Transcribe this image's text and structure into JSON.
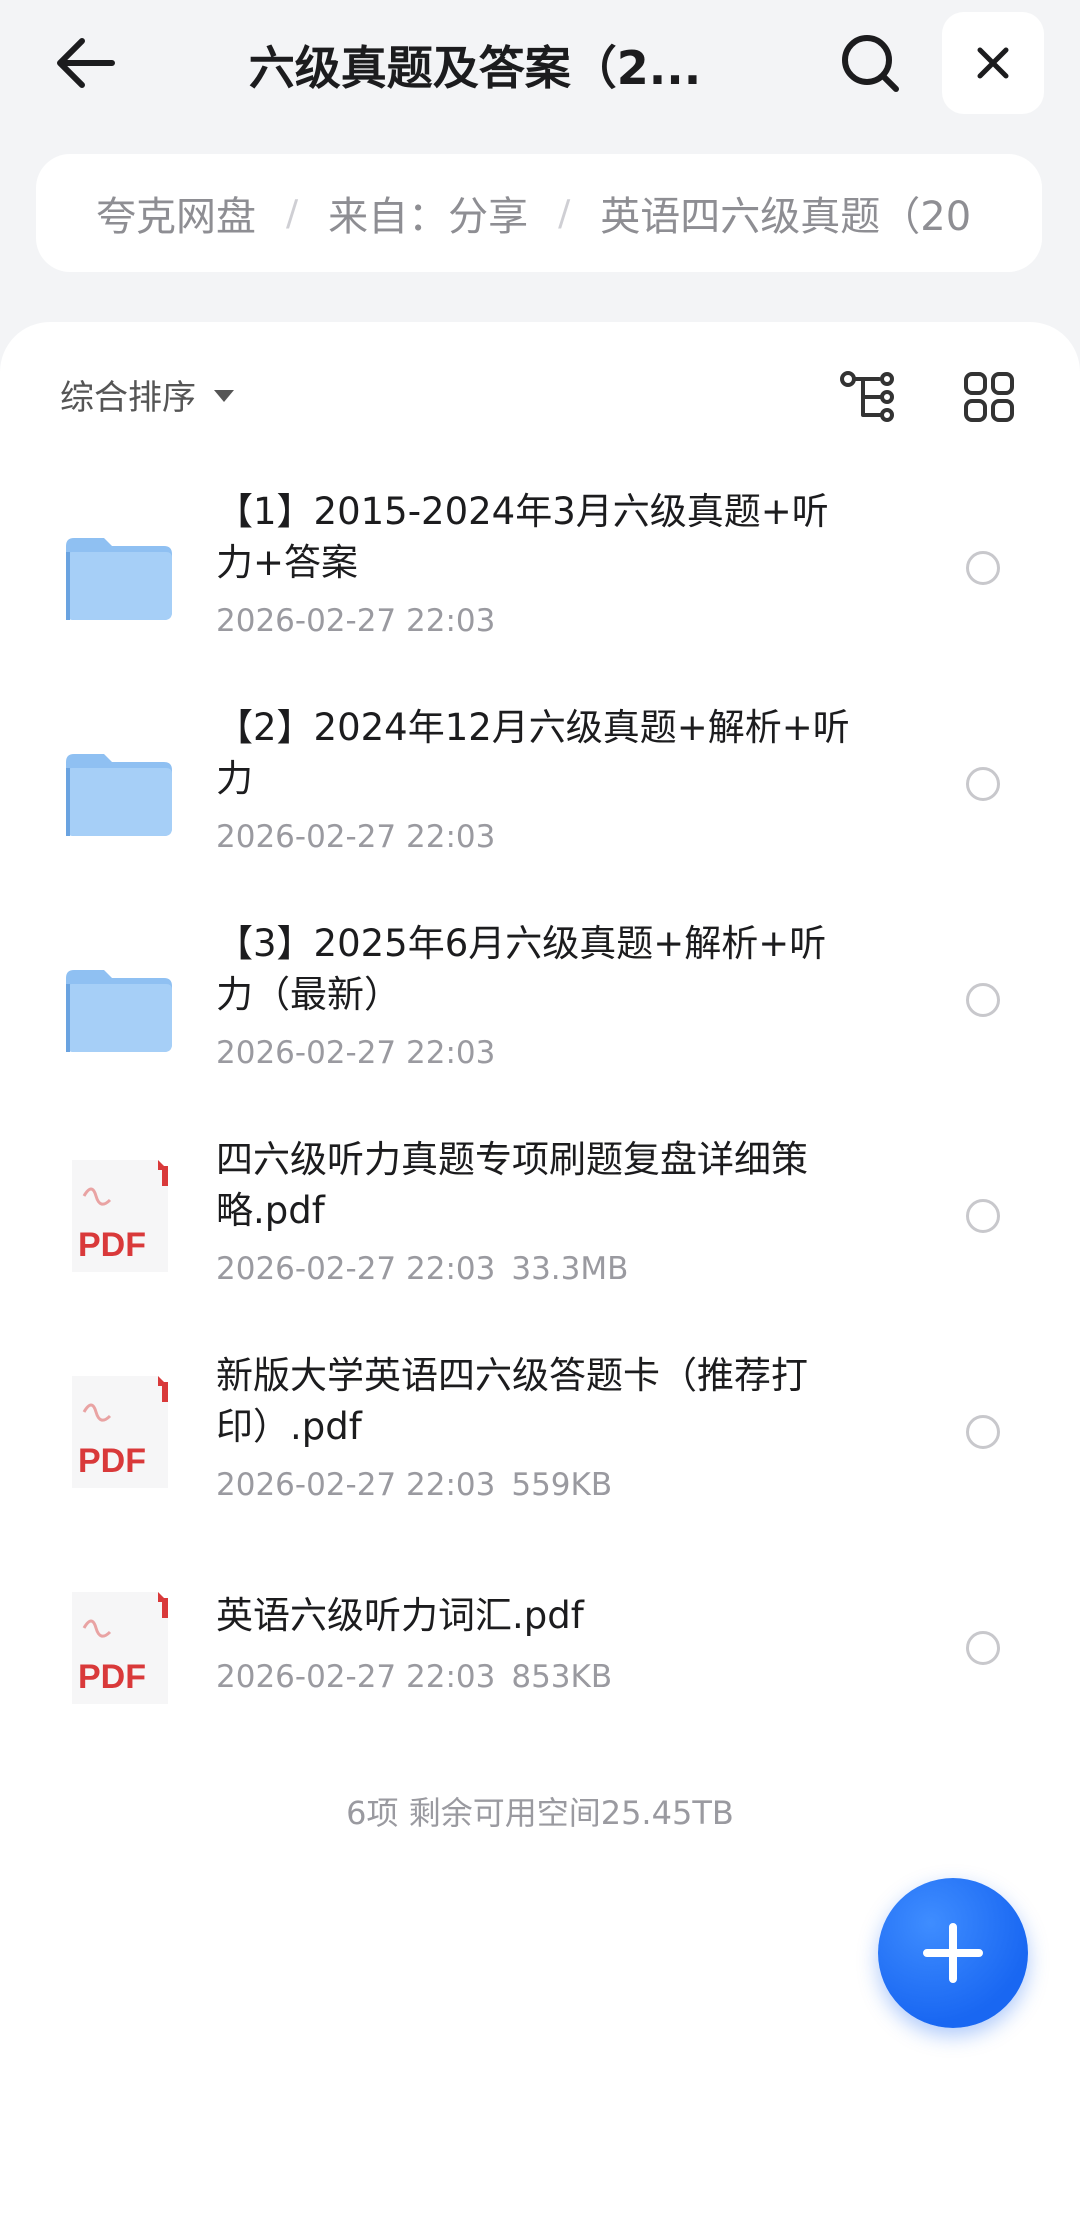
{
  "header": {
    "title": "六级真题及答案（2...",
    "back_icon": "arrow-left-icon",
    "search_icon": "search-icon",
    "close_icon": "close-icon"
  },
  "breadcrumb": {
    "items": [
      "夸克网盘",
      "来自：分享",
      "英语四六级真题（20"
    ],
    "separator": "/"
  },
  "toolbar": {
    "sort_label": "综合排序",
    "tree_icon": "tree-view-icon",
    "grid_icon": "grid-view-icon"
  },
  "files": [
    {
      "type": "folder",
      "name": "【1】2015-2024年3月六级真题+听力+答案",
      "date": "2026-02-27 22:03",
      "size": ""
    },
    {
      "type": "folder",
      "name": "【2】2024年12月六级真题+解析+听力",
      "date": "2026-02-27 22:03",
      "size": ""
    },
    {
      "type": "folder",
      "name": "【3】2025年6月六级真题+解析+听力（最新）",
      "date": "2026-02-27 22:03",
      "size": ""
    },
    {
      "type": "pdf",
      "name": "四六级听力真题专项刷题复盘详细策略.pdf",
      "date": "2026-02-27 22:03",
      "size": "33.3MB"
    },
    {
      "type": "pdf",
      "name": "新版大学英语四六级答题卡（推荐打印）.pdf",
      "date": "2026-02-27 22:03",
      "size": "559KB"
    },
    {
      "type": "pdf",
      "name": "英语六级听力词汇.pdf",
      "date": "2026-02-27 22:03",
      "size": "853KB"
    }
  ],
  "pdf_badge": "PDF",
  "summary": "6项 剩余可用空间25.45TB",
  "fab_icon": "plus-icon",
  "colors": {
    "accent": "#1967f2",
    "folder": "#7fb5ee",
    "pdf_red": "#d9393a"
  }
}
